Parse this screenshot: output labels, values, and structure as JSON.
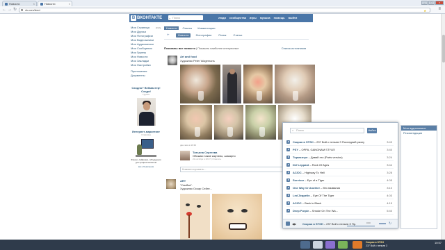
{
  "browser": {
    "tabs": [
      {
        "label": "Новости"
      },
      {
        "label": "Новости"
      }
    ],
    "url": "vk.com/feed"
  },
  "vk": {
    "logo": "ВКОНТАКТЕ",
    "logo_letter": "В",
    "search_placeholder": "Поиск",
    "nav": [
      "люди",
      "сообщества",
      "игры",
      "музыка",
      "помощь",
      "выйти"
    ]
  },
  "left_menu": {
    "edit": "ред.",
    "items": [
      "Моя Страница",
      "Мои Друзья",
      "Мои Фотографии",
      "Мои Видеозаписи",
      "Мои Аудиозаписи",
      "Мои Сообщения",
      "Мои Группы",
      "Мои Новости",
      "Мои Закладки",
      "Мои Настройки",
      "Приложения",
      "Документы"
    ]
  },
  "promo": {
    "title1": "Сходно? Вебмастер! Сходи!",
    "sub1": "Группа",
    "title2": "Интернет-маркетинг",
    "sub2": "Страница",
    "text2": "Фишки, лайфхаки, обсуждения для профессионалов!",
    "footer": "все объявления"
  },
  "feed": {
    "top_tabs": [
      "Новости",
      "Ответы",
      "Комментарии"
    ],
    "filter_tabs": [
      "Новости",
      "Фотографии",
      "Поиск",
      "Статьи"
    ],
    "shown_bold": "Показаны все новости",
    "shown_link": "Показать наиболее интересные",
    "sources": "Список источников"
  },
  "post1": {
    "author": "Art and food",
    "subtitle": "Художник Peter Wagemans",
    "date": "два часа в 16:39",
    "actions": "Поделиться",
    "comment_author": "Татьяна Сергеева",
    "comment_text": "Обожаю такие картины, шикарно",
    "comment_date": "22 октября в 18:27 | Ответить",
    "comment_placeholder": "Комментировать..."
  },
  "post2": {
    "author": "ART",
    "text": "\"Улыбка\".",
    "subtitle": "Художник Оскар Сейнт..."
  },
  "player": {
    "search_placeholder": "Поиск",
    "button": "Найти",
    "tracks": [
      {
        "artist": "Скорая в STSH",
        "title": "237 Вой с пеньев З Последний разлу",
        "duration": "3:49"
      },
      {
        "artist": "PSY",
        "title": "OPPA, GANGNAM STYLE!",
        "duration": "3:40"
      },
      {
        "artist": "Тормознул",
        "title": "Давай это (Parts version)",
        "duration": "3:24"
      },
      {
        "artist": "Def Leppard",
        "title": "Rock Of Ages",
        "duration": "3:44"
      },
      {
        "artist": "AC/DC",
        "title": "Highway To Hell",
        "duration": "3:28"
      },
      {
        "artist": "Survivor",
        "title": "Eye of a Tiger",
        "duration": "4:05"
      },
      {
        "artist": "One Way Or Another",
        "title": "без названия",
        "duration": "3:10"
      },
      {
        "artist": "Led Zeppelin",
        "title": "Eye Of The Tiger",
        "duration": "4:03"
      },
      {
        "artist": "AC/DC",
        "title": "Back in Black",
        "duration": "4:15"
      },
      {
        "artist": "Deep Purple",
        "title": "Smoke On The Wa...",
        "duration": "5:40"
      }
    ],
    "now_artist": "Скорая в STSH",
    "now_title": "237 Вой с пеньев З Пр.",
    "time": "0:00",
    "repeat": "↻"
  },
  "side_panel": {
    "items": [
      "Мои аудиозаписи",
      "Рекомендации"
    ]
  },
  "taskbar": {
    "now_artist": "Скорая в STSH",
    "now_title": "237 Вой с пеньев 3",
    "time": "10:57"
  },
  "colors": {
    "vk_blue": "#4a76a8",
    "link": "#2b587a"
  }
}
